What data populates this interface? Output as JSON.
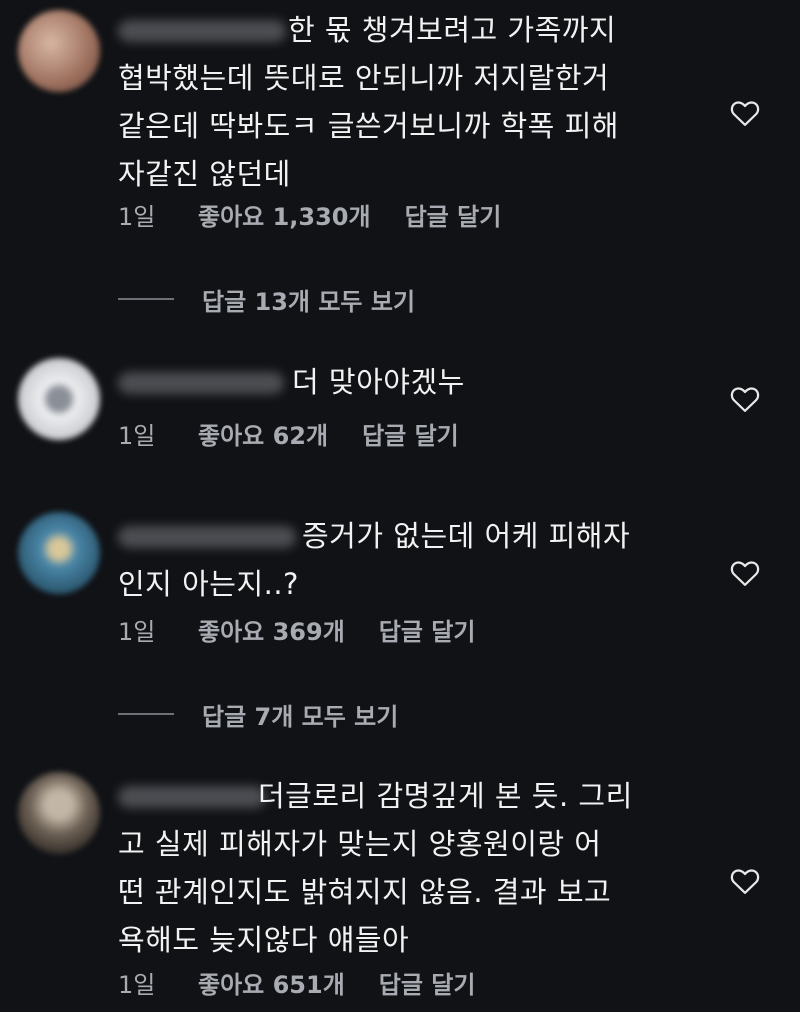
{
  "comments": [
    {
      "text": "한 몫 챙겨보려고 가족까지\n협박했는데 뜻대로 안되니까 저지랄한거\n같은데 딱봐도ㅋ 글쓴거보니까 학폭 피해\n자같진 않던데",
      "time": "1일",
      "likes": "좋아요 1,330개",
      "reply": "답글 달기",
      "view_replies": "답글 13개 모두 보기",
      "avatar_color": "#b48a78"
    },
    {
      "text": "더 맞아야겠누",
      "time": "1일",
      "likes": "좋아요 62개",
      "reply": "답글 달기",
      "avatar_color": "#d8d9dc"
    },
    {
      "text": "증거가 없는데 어케 피해자\n인지 아는지..?",
      "time": "1일",
      "likes": "좋아요 369개",
      "reply": "답글 달기",
      "view_replies": "답글 7개 모두 보기",
      "avatar_color": "#3e6f8e"
    },
    {
      "text": "더글로리 감명깊게 본 듯. 그리\n고 실제 피해자가 맞는지 양홍원이랑 어\n떤 관계인지도 밝혀지지 않음. 결과 보고\n욕해도 늦지않다 얘들아",
      "time": "1일",
      "likes": "좋아요 651개",
      "reply": "답글 달기",
      "avatar_color": "#8c7c6c"
    }
  ],
  "colors": {
    "background": "#101216",
    "text": "#f2f2f2",
    "meta": "#a8abb1"
  },
  "icons": {
    "like": "heart-outline-icon"
  }
}
